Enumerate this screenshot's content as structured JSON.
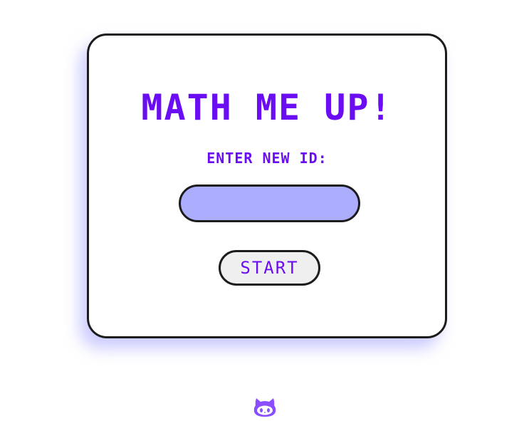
{
  "app": {
    "title": "MATH ME UP!",
    "accent_color": "#6a0df2",
    "input_fill_color": "#acadfc"
  },
  "form": {
    "label": "ENTER NEW ID:",
    "id_input": {
      "value": "",
      "placeholder": ""
    },
    "start_label": "START"
  },
  "footer": {
    "icon": "github-octocat-icon",
    "icon_color": "#8a4dff"
  }
}
